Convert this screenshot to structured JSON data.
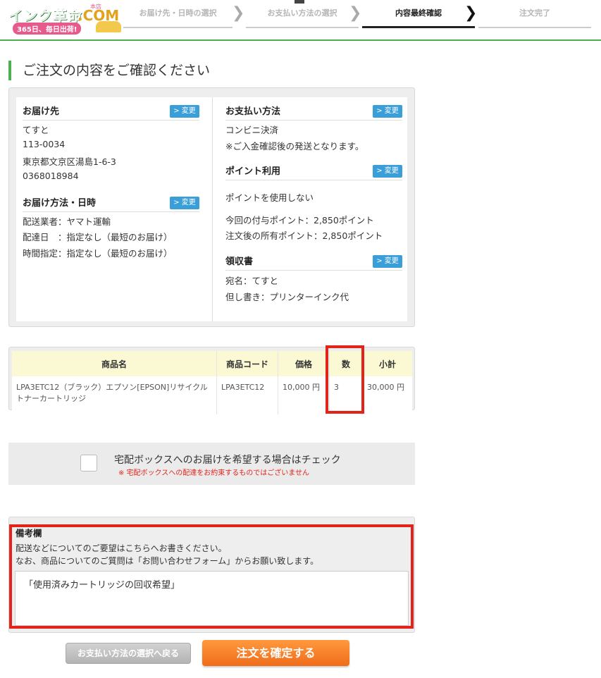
{
  "logo": {
    "main": "インク革命",
    "com": ".COM",
    "badge": "本店",
    "sub": "365日、毎日出荷!"
  },
  "steps": [
    {
      "label": "お届け先・日時の選択"
    },
    {
      "label": "お支払い方法の選択"
    },
    {
      "label": "内容最終確認"
    },
    {
      "label": "注文完了"
    }
  ],
  "page_title": "ご注文の内容をご確認ください",
  "change_label": "> 変更",
  "delivery": {
    "title": "お届け先",
    "name": "てすと",
    "zip": "113-0034",
    "address": "東京都文京区湯島1-6-3",
    "phone": "0368018984"
  },
  "shipping": {
    "title": "お届け方法・日時",
    "carrier": "配送業者：ヤマト運輸",
    "date": "配達日　：指定なし（最短のお届け）",
    "time": "時間指定：指定なし（最短のお届け）"
  },
  "payment": {
    "title": "お支払い方法",
    "method": "コンビニ決済",
    "note": "※ご入金確認後の発送となります。"
  },
  "points": {
    "title": "ポイント利用",
    "usage": "ポイントを使用しない",
    "granted": "今回の付与ポイント：2,850ポイント",
    "owned": "注文後の所有ポイント：2,850ポイント"
  },
  "receipt": {
    "title": "領収書",
    "addressee": "宛名：てすと",
    "proviso": "但し書き：プリンターインク代"
  },
  "table": {
    "headers": [
      "商品名",
      "商品コード",
      "価格",
      "数",
      "小計"
    ],
    "rows": [
      {
        "name": "LPA3ETC12（ブラック）エプソン[EPSON]リサイクルトナーカートリッジ",
        "code": "LPA3ETC12",
        "price": "10,000 円",
        "qty": "3",
        "subtotal": "30,000 円"
      }
    ]
  },
  "delivery_box": {
    "label": "宅配ボックスへのお届けを希望する場合はチェック",
    "note": "※ 宅配ボックスへの配達をお約束するものではございません"
  },
  "remarks": {
    "title": "備考欄",
    "desc1": "配送などについてのご要望はこちらへお書きください。",
    "desc2": "なお、商品についてのご質問は「お問い合わせフォーム」からお願い致します。",
    "value": "「使用済みカートリッジの回収希望」"
  },
  "buttons": {
    "back": "お支払い方法の選択へ戻る",
    "confirm": "注文を確定する"
  },
  "colors": {
    "accent": "#4caf50",
    "highlight": "#e3241b",
    "change_button": "#3a9fd8",
    "confirm_button": "#f06c1b"
  }
}
